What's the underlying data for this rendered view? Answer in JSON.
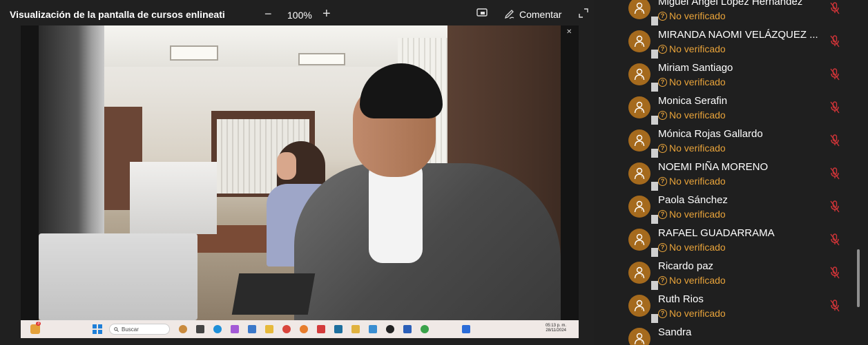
{
  "header": {
    "title": "Visualización de la pantalla de cursos enlineati",
    "zoom_out": "−",
    "zoom": "100%",
    "zoom_in": "+",
    "comment_label": "Comentar"
  },
  "video": {
    "controls": [
      "–",
      "▫",
      "✕"
    ],
    "taskbar": {
      "search_label": "Buscar",
      "time": "05:13 p. m.",
      "date": "28/11/2024",
      "notification_count": "3"
    }
  },
  "participants": {
    "status_label": "No verificado",
    "items": [
      {
        "name": "Miguel Ángel Lopez Hernández",
        "status": "No verificado"
      },
      {
        "name": "MIRANDA NAOMI VELÁZQUEZ ...",
        "status": "No verificado"
      },
      {
        "name": "Miriam Santiago",
        "status": "No verificado"
      },
      {
        "name": "Monica Serafin",
        "status": "No verificado"
      },
      {
        "name": "Mónica Rojas Gallardo",
        "status": "No verificado"
      },
      {
        "name": "NOEMI PIÑA MORENO",
        "status": "No verificado"
      },
      {
        "name": "Paola Sánchez",
        "status": "No verificado"
      },
      {
        "name": "RAFAEL GUADARRAMA",
        "status": "No verificado"
      },
      {
        "name": "Ricardo paz",
        "status": "No verificado"
      },
      {
        "name": "Ruth Rios",
        "status": "No verificado"
      },
      {
        "name": "Sandra",
        "status": ""
      }
    ]
  },
  "colors": {
    "background": "#1f1f1f",
    "avatar": "#a56a1d",
    "status": "#e8a33a",
    "mic_muted": "#d13438"
  }
}
